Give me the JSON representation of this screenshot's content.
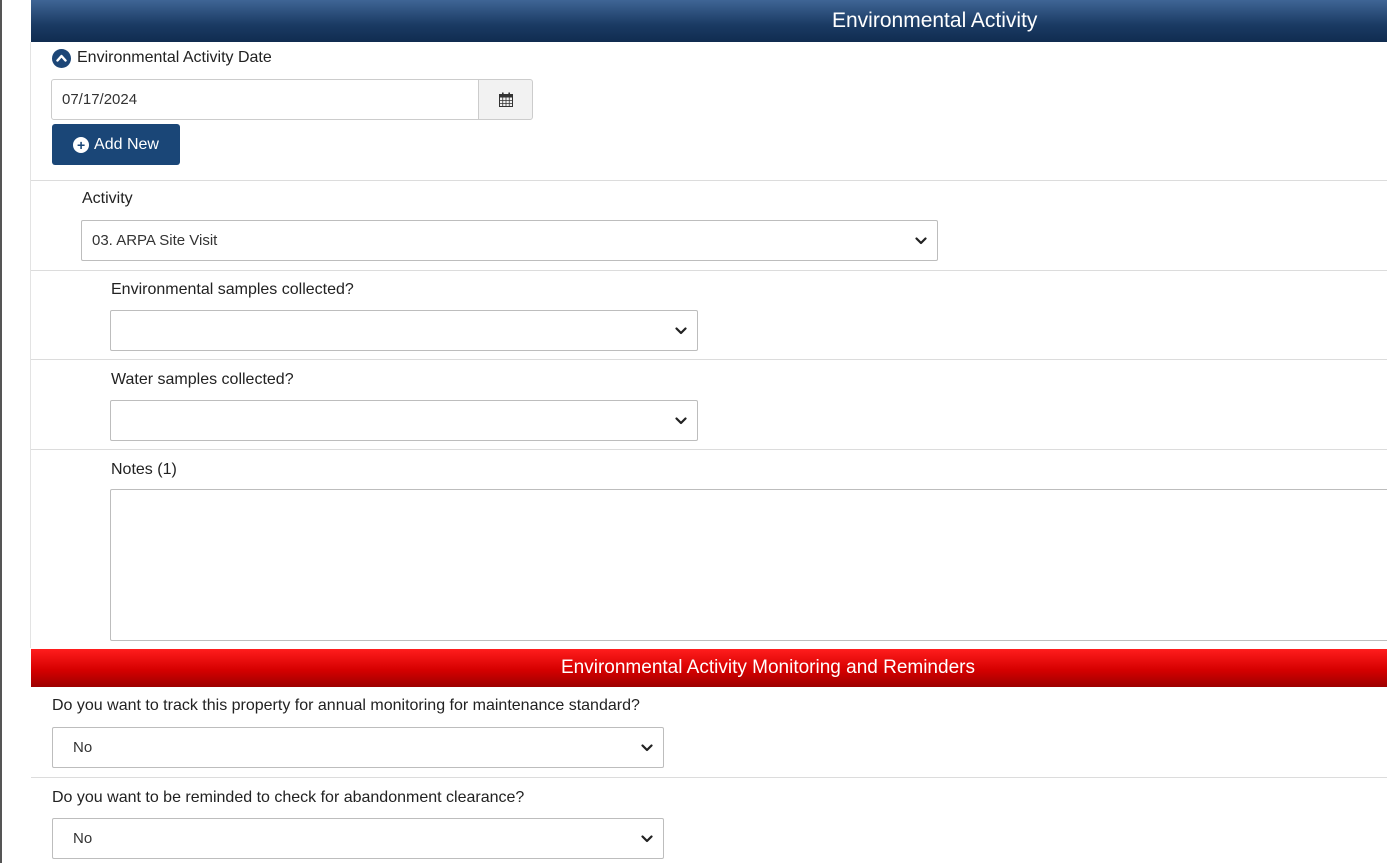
{
  "section_header": {
    "title": "Environmental Activity"
  },
  "date_field": {
    "label": "Environmental Activity Date",
    "value": "07/17/2024",
    "toggle_icon": "chevron-up-circle-icon",
    "calendar_icon": "calendar-icon"
  },
  "add_new_button": {
    "label": "Add New",
    "icon": "plus-circle-icon"
  },
  "activity": {
    "label": "Activity",
    "selected": "03. ARPA Site Visit"
  },
  "environmental_samples": {
    "label": "Environmental samples collected?",
    "selected": ""
  },
  "water_samples": {
    "label": "Water samples collected?",
    "selected": ""
  },
  "notes": {
    "label": "Notes (1)",
    "value": ""
  },
  "monitoring_header": {
    "title": "Environmental Activity Monitoring and Reminders"
  },
  "annual_monitoring": {
    "question": "Do you want to track this property for annual monitoring for maintenance standard?",
    "selected": "No"
  },
  "abandonment_reminder": {
    "question": "Do you want to be reminded to check for abandonment clearance?",
    "selected": "No"
  },
  "colors": {
    "header_blue": "#1a3a63",
    "header_red": "#d50000",
    "button_blue": "#1a4677"
  }
}
